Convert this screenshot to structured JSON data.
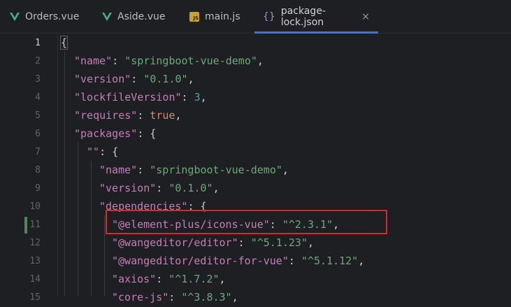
{
  "tabs": [
    {
      "label": "Orders.vue",
      "icon": "vue-icon"
    },
    {
      "label": "Aside.vue",
      "icon": "vue-icon"
    },
    {
      "label": "main.js",
      "icon": "js-icon"
    },
    {
      "label": "package-lock.json",
      "icon": "json-icon",
      "active": true
    }
  ],
  "tab_icons": {
    "js": "JS",
    "json": "{}",
    "close": "×"
  },
  "line_numbers": [
    "1",
    "2",
    "3",
    "4",
    "5",
    "6",
    "7",
    "8",
    "9",
    "10",
    "11",
    "12",
    "13",
    "14",
    "15"
  ],
  "code": {
    "l1": {
      "brace": "{"
    },
    "l2": {
      "key": "\"name\"",
      "colon": ": ",
      "value": "\"springboot-vue-demo\"",
      "comma": ","
    },
    "l3": {
      "key": "\"version\"",
      "colon": ": ",
      "value": "\"0.1.0\"",
      "comma": ","
    },
    "l4": {
      "key": "\"lockfileVersion\"",
      "colon": ": ",
      "value": "3",
      "comma": ","
    },
    "l5": {
      "key": "\"requires\"",
      "colon": ": ",
      "value": "true",
      "comma": ","
    },
    "l6": {
      "key": "\"packages\"",
      "colon": ": ",
      "value": "{"
    },
    "l7": {
      "key": "\"\"",
      "colon": ": ",
      "value": "{"
    },
    "l8": {
      "key": "\"name\"",
      "colon": ": ",
      "value": "\"springboot-vue-demo\"",
      "comma": ","
    },
    "l9": {
      "key": "\"version\"",
      "colon": ": ",
      "value": "\"0.1.0\"",
      "comma": ","
    },
    "l10": {
      "key": "\"dependencies\"",
      "colon": ": ",
      "value": "{"
    },
    "l11": {
      "key": "\"@element-plus/icons-vue\"",
      "colon": ": ",
      "value": "\"^2.3.1\"",
      "comma": ","
    },
    "l12": {
      "key": "\"@wangeditor/editor\"",
      "colon": ": ",
      "value": "\"^5.1.23\"",
      "comma": ","
    },
    "l13": {
      "key": "\"@wangeditor/editor-for-vue\"",
      "colon": ": ",
      "value": "\"^5.1.12\"",
      "comma": ","
    },
    "l14": {
      "key": "\"axios\"",
      "colon": ": ",
      "value": "\"^1.7.2\"",
      "comma": ","
    },
    "l15": {
      "key": "\"core-js\"",
      "colon": ": ",
      "value": "\"^3.8.3\"",
      "comma": ","
    }
  },
  "colors": {
    "key": "#c77dbb",
    "string": "#6aab73",
    "number": "#2aacb8",
    "keyword": "#cf8e6d",
    "highlight": "#d62a2a",
    "accent": "#3574f0"
  }
}
